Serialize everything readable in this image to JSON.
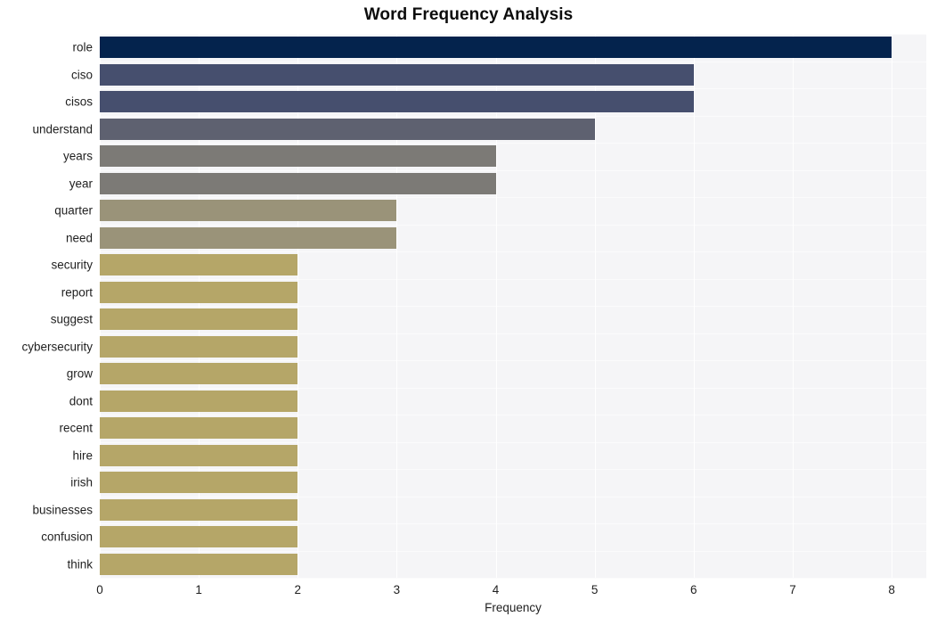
{
  "chart_data": {
    "type": "bar",
    "orientation": "horizontal",
    "title": "Word Frequency Analysis",
    "xlabel": "Frequency",
    "ylabel": "",
    "categories": [
      "role",
      "ciso",
      "cisos",
      "understand",
      "years",
      "year",
      "quarter",
      "need",
      "security",
      "report",
      "suggest",
      "cybersecurity",
      "grow",
      "dont",
      "recent",
      "hire",
      "irish",
      "businesses",
      "confusion",
      "think"
    ],
    "values": [
      8,
      6,
      6,
      5,
      4,
      4,
      3,
      3,
      2,
      2,
      2,
      2,
      2,
      2,
      2,
      2,
      2,
      2,
      2,
      2
    ],
    "bar_colors": [
      "#04234d",
      "#464f6e",
      "#464f6e",
      "#5e6170",
      "#7c7a76",
      "#7c7a76",
      "#9a9379",
      "#9a9379",
      "#b5a668",
      "#b5a668",
      "#b5a668",
      "#b5a668",
      "#b5a668",
      "#b5a668",
      "#b5a668",
      "#b5a668",
      "#b5a668",
      "#b5a668",
      "#b5a668",
      "#b5a668"
    ],
    "xlim": [
      0,
      8.35
    ],
    "xticks": [
      0,
      1,
      2,
      3,
      4,
      5,
      6,
      7,
      8
    ],
    "xtick_labels": [
      "0",
      "1",
      "2",
      "3",
      "4",
      "5",
      "6",
      "7",
      "8"
    ],
    "grid": true,
    "grid_axis": "both",
    "legend": false,
    "plot_background": "#f5f5f7",
    "figure_background": "#ffffff",
    "gridline_color": "#ffffff"
  }
}
